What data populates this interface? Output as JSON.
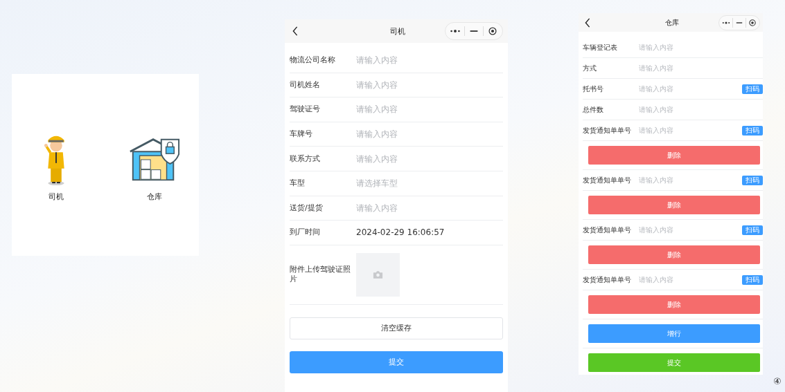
{
  "home": {
    "items": [
      {
        "label": "司机",
        "kind": "driver"
      },
      {
        "label": "仓库",
        "kind": "warehouse"
      }
    ]
  },
  "driver_form": {
    "title": "司机",
    "fields": [
      {
        "label": "物流公司名称",
        "kind": "input",
        "placeholder": "请输入内容"
      },
      {
        "label": "司机姓名",
        "kind": "input",
        "placeholder": "请输入内容"
      },
      {
        "label": "驾驶证号",
        "kind": "input",
        "placeholder": "请输入内容"
      },
      {
        "label": "车牌号",
        "kind": "input",
        "placeholder": "请输入内容"
      },
      {
        "label": "联系方式",
        "kind": "input",
        "placeholder": "请输入内容"
      },
      {
        "label": "车型",
        "kind": "select",
        "placeholder": "请选择车型"
      },
      {
        "label": "送货/提货",
        "kind": "input",
        "placeholder": "请输入内容"
      },
      {
        "label": "到厂时间",
        "kind": "value",
        "value": "2024-02-29 16:06:57"
      },
      {
        "label": "附件上传驾驶证照片",
        "kind": "upload"
      }
    ],
    "buttons": [
      {
        "label": "清空缓存",
        "kind": "outline"
      },
      {
        "label": "提交",
        "kind": "primary"
      }
    ]
  },
  "warehouse_form": {
    "title": "仓库",
    "rows": [
      {
        "kind": "field",
        "label": "车辆登记表",
        "placeholder": "请输入内容"
      },
      {
        "kind": "field",
        "label": "方式",
        "placeholder": "请输入内容"
      },
      {
        "kind": "field",
        "label": "托书号",
        "placeholder": "请输入内容",
        "scan": "扫码"
      },
      {
        "kind": "field",
        "label": "总件数",
        "placeholder": "请输入内容"
      },
      {
        "kind": "field",
        "label": "发货通知单单号",
        "placeholder": "请输入内容",
        "scan": "扫码"
      },
      {
        "kind": "delete",
        "label": "删除"
      },
      {
        "kind": "field",
        "label": "发货通知单单号",
        "placeholder": "请输入内容",
        "scan": "扫码"
      },
      {
        "kind": "delete",
        "label": "删除"
      },
      {
        "kind": "field",
        "label": "发货通知单单号",
        "placeholder": "请输入内容",
        "scan": "扫码"
      },
      {
        "kind": "delete",
        "label": "删除"
      },
      {
        "kind": "field",
        "label": "发货通知单单号",
        "placeholder": "请输入内容",
        "scan": "扫码"
      },
      {
        "kind": "delete",
        "label": "删除"
      },
      {
        "kind": "add",
        "label": "增行"
      },
      {
        "kind": "submit",
        "label": "提交"
      }
    ]
  },
  "page_number": "④"
}
